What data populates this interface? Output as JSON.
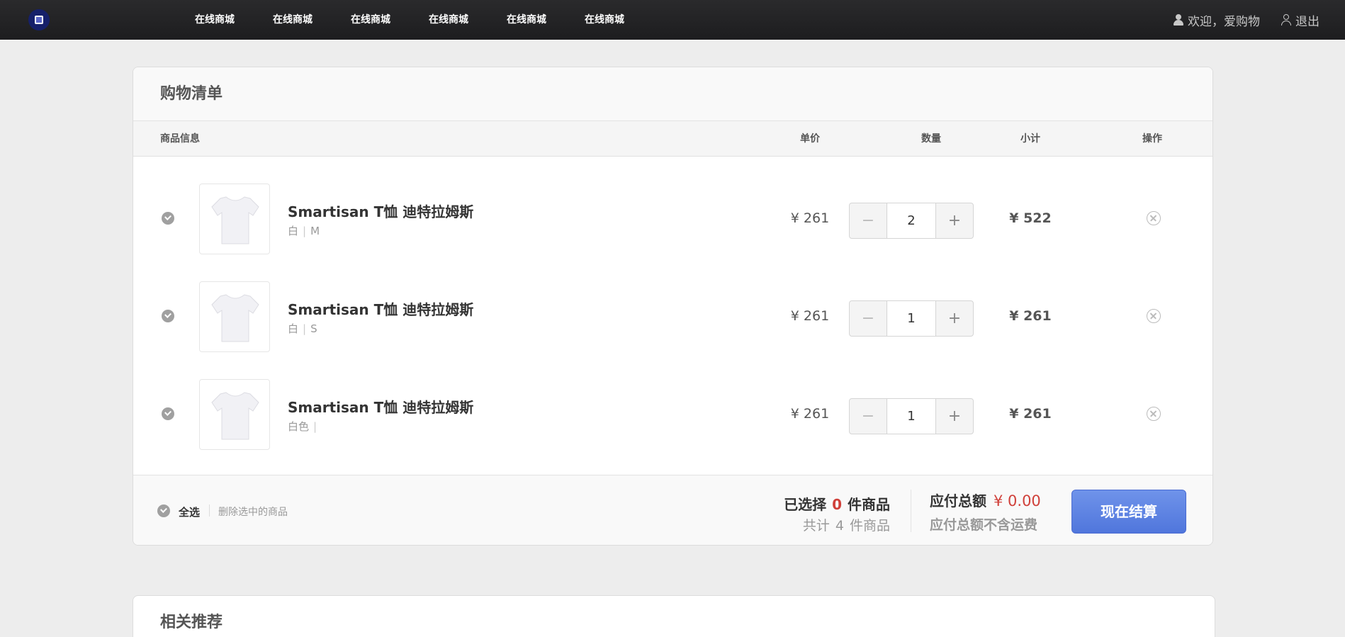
{
  "nav": {
    "items": [
      "在线商城",
      "在线商城",
      "在线商城",
      "在线商城",
      "在线商城",
      "在线商城"
    ],
    "welcome": "欢迎，爱购物",
    "logout": "退出"
  },
  "cart": {
    "title": "购物清单",
    "columns": {
      "info": "商品信息",
      "price": "单价",
      "qty": "数量",
      "subtotal": "小计",
      "action": "操作"
    },
    "items": [
      {
        "name": "Smartisan T恤 迪特拉姆斯",
        "color": "白",
        "size": "M",
        "price": "¥ 261",
        "qty": "2",
        "subtotal": "¥ 522",
        "checked": true
      },
      {
        "name": "Smartisan T恤 迪特拉姆斯",
        "color": "白",
        "size": "S",
        "price": "¥ 261",
        "qty": "1",
        "subtotal": "¥ 261",
        "checked": true
      },
      {
        "name": "Smartisan T恤 迪特拉姆斯",
        "color": "白色",
        "size": "",
        "price": "¥ 261",
        "qty": "1",
        "subtotal": "¥ 261",
        "checked": true
      }
    ],
    "qty_minus": "−",
    "qty_plus": "+",
    "footer": {
      "select_all": "全选",
      "delete_selected": "删除选中的商品",
      "selected_prefix": "已选择",
      "selected_count": "0",
      "selected_suffix": "件商品",
      "total_prefix": "共计",
      "total_count": "4",
      "total_suffix": "件商品",
      "amount_label": "应付总额",
      "amount_value": "¥  0.00",
      "shipping_note": "应付总额不含运费",
      "checkout": "现在结算"
    }
  },
  "recommend": {
    "title": "相关推荐"
  },
  "colors": {
    "topbar": "#1f1f21",
    "accent_red": "#d0403a",
    "checkout_blue": "#5a7fe0"
  }
}
